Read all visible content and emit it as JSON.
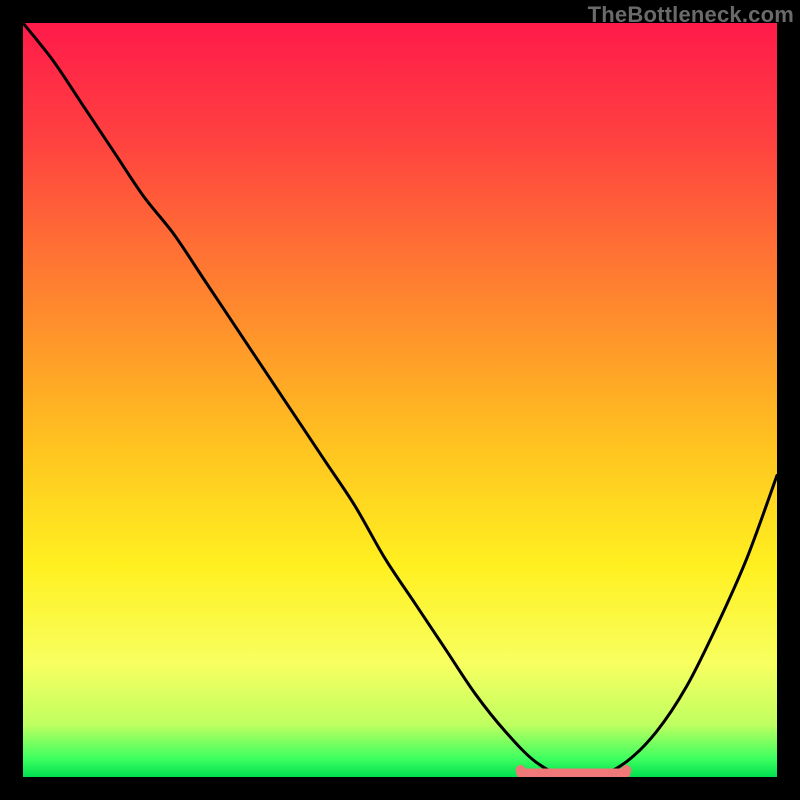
{
  "watermark": "TheBottleneck.com",
  "chart_data": {
    "type": "line",
    "title": "",
    "xlabel": "",
    "ylabel": "",
    "xlim": [
      0,
      100
    ],
    "ylim": [
      0,
      100
    ],
    "grid": false,
    "legend": false,
    "series": [
      {
        "name": "curve",
        "color": "#000000",
        "x": [
          0,
          4,
          8,
          12,
          16,
          20,
          24,
          28,
          32,
          36,
          40,
          44,
          48,
          52,
          56,
          60,
          64,
          68,
          72,
          76,
          80,
          84,
          88,
          92,
          96,
          100
        ],
        "y": [
          100,
          95,
          89,
          83,
          77,
          72,
          66,
          60,
          54,
          48,
          42,
          36,
          29,
          23,
          17,
          11,
          6,
          2,
          0,
          0,
          2,
          6,
          12,
          20,
          29,
          40
        ]
      },
      {
        "name": "zero-band",
        "color": "#f07878",
        "x": [
          66,
          80
        ],
        "y": [
          0,
          0
        ]
      }
    ],
    "gradient_stops": [
      {
        "offset": 0.0,
        "color": "#ff1a4a"
      },
      {
        "offset": 0.15,
        "color": "#ff4040"
      },
      {
        "offset": 0.35,
        "color": "#ff8030"
      },
      {
        "offset": 0.55,
        "color": "#ffc020"
      },
      {
        "offset": 0.72,
        "color": "#fff020"
      },
      {
        "offset": 0.85,
        "color": "#f8ff60"
      },
      {
        "offset": 0.93,
        "color": "#c0ff60"
      },
      {
        "offset": 0.975,
        "color": "#40ff60"
      },
      {
        "offset": 1.0,
        "color": "#00e050"
      }
    ]
  }
}
